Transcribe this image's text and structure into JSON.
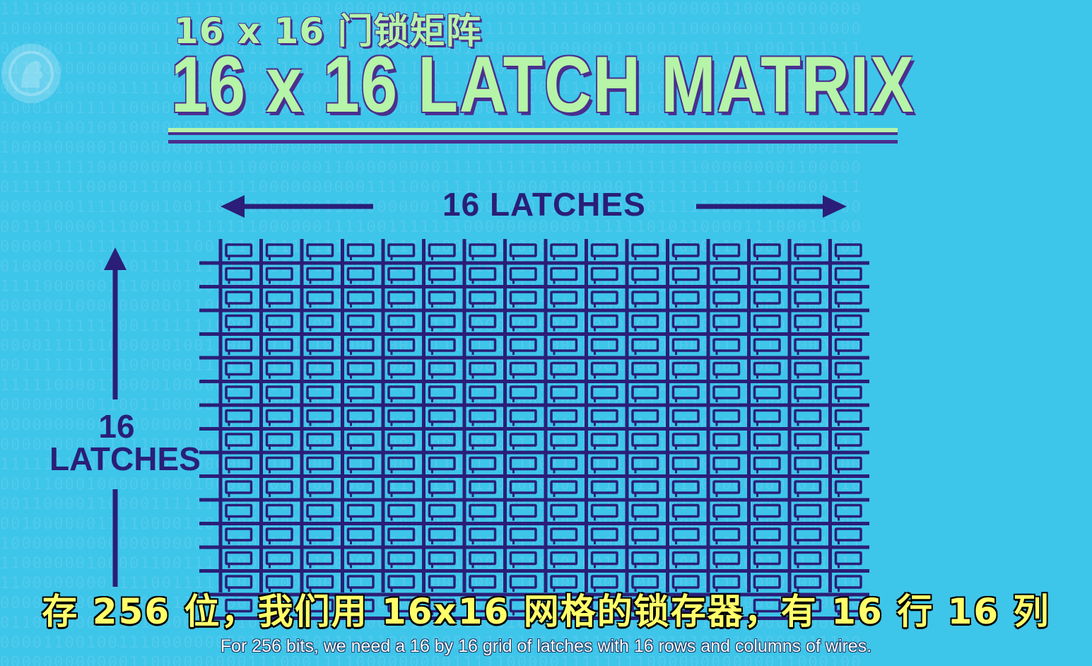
{
  "title": {
    "cn": "16 x 16 门锁矩阵",
    "en": "16 x 16 LATCH MATRIX"
  },
  "labels": {
    "columns": "16 LATCHES",
    "rows_line1": "16",
    "rows_line2": "LATCHES"
  },
  "matrix": {
    "rows": 16,
    "columns": 16
  },
  "subtitles": {
    "cn": "存 256 位，我们用 16x16 网格的锁存器，有 16 行 16 列",
    "en": "For 256 bits, we need a 16 by 16 grid of latches with 16 rows and columns of wires."
  },
  "colors": {
    "background": "#3ec5ea",
    "ink": "#2a1e78",
    "title_fill": "#b6f4a8",
    "subtitle_cn": "#ffff6a"
  },
  "icons": {
    "logo": "pbs-logo-icon"
  }
}
